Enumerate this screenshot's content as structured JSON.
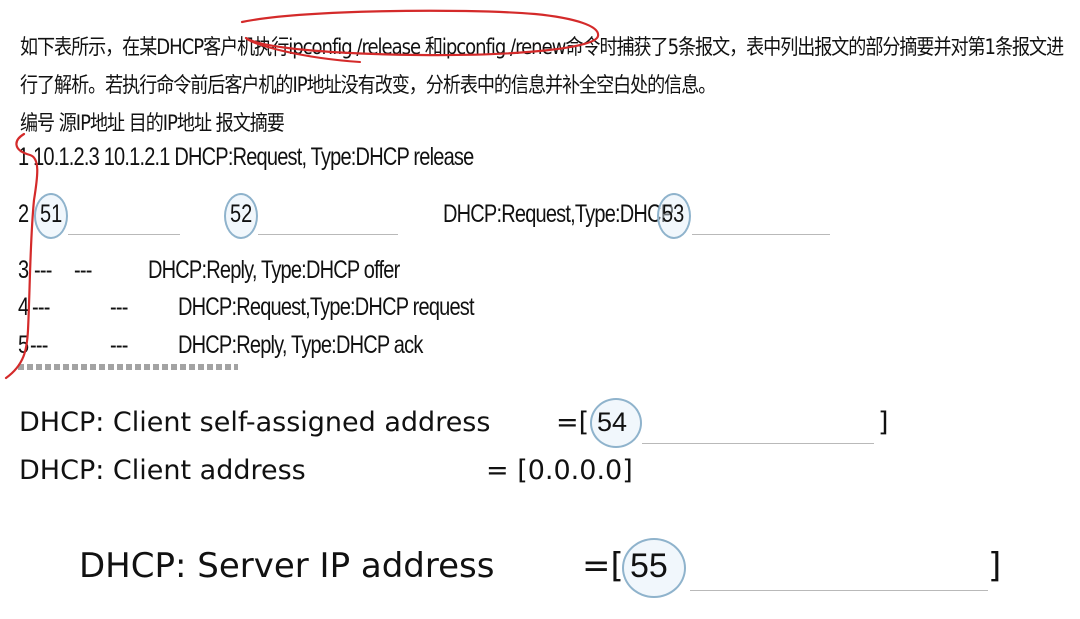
{
  "question": {
    "line1": "如下表所示，在某DHCP客户机执行ipconfig /release 和ipconfig /renew命令时捕获了5条报文，表中列出报文的部分摘要并对第1条报文进",
    "line2": "行了解析。若执行命令前后客户机的IP地址没有改变，分析表中的信息并补全空白处的信息。"
  },
  "table": {
    "header": "编号 源IP地址 目的IP地址 报文摘要",
    "row1": "1 10.1.2.3 10.1.2.1 DHCP:Request, Type:DHCP release",
    "row2": {
      "no": "2",
      "blank_src": "51",
      "blank_dst": "52",
      "summary": "DHCP:Request,Type:DHCP",
      "blank_type": "53"
    },
    "row3": {
      "no": "3",
      "src": "---",
      "dst": "---",
      "summary": "DHCP:Reply, Type:DHCP offer"
    },
    "row4": {
      "no": "4",
      "src": "---",
      "dst": "---",
      "summary": "DHCP:Request,Type:DHCP request"
    },
    "row5": {
      "no": "5",
      "src": "---",
      "dst": "---",
      "summary": "DHCP:Reply, Type:DHCP ack"
    }
  },
  "detail": {
    "self_assigned": {
      "label": "DHCP: Client self-assigned address",
      "eq": "=[",
      "blank": "54",
      "close": "]"
    },
    "client_address": {
      "label": "DHCP: Client address",
      "eq": "= [0.0.0.0]"
    },
    "server_ip": {
      "label": "DHCP: Server IP address",
      "eq": "=[",
      "blank": "55",
      "close": "]"
    }
  },
  "colors": {
    "ink": "#111111",
    "annotation": "#d42a2a",
    "circle": "#8fb3cc"
  }
}
